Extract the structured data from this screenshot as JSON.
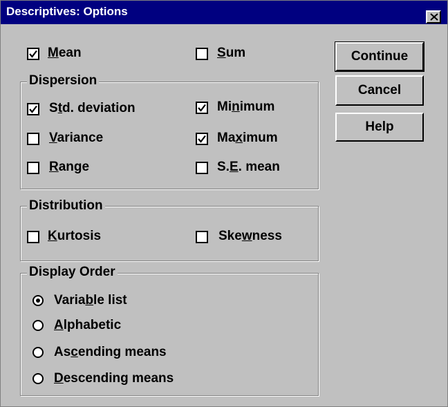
{
  "window": {
    "title": "Descriptives: Options"
  },
  "top_options": [
    {
      "label_parts": [
        "",
        "M",
        "ean"
      ],
      "checked": true
    },
    {
      "label_parts": [
        "",
        "S",
        "um"
      ],
      "checked": false
    }
  ],
  "dispersion": {
    "title": "Dispersion",
    "items": [
      {
        "label_parts": [
          "S",
          "t",
          "d. deviation"
        ],
        "checked": true
      },
      {
        "label_parts": [
          "Mi",
          "n",
          "imum"
        ],
        "checked": true
      },
      {
        "label_parts": [
          "",
          "V",
          "ariance"
        ],
        "checked": false
      },
      {
        "label_parts": [
          "Ma",
          "x",
          "imum"
        ],
        "checked": true
      },
      {
        "label_parts": [
          "",
          "R",
          "ange"
        ],
        "checked": false
      },
      {
        "label_parts": [
          "S.",
          "E",
          ". mean"
        ],
        "checked": false
      }
    ]
  },
  "distribution": {
    "title": "Distribution",
    "items": [
      {
        "label_parts": [
          "",
          "K",
          "urtosis"
        ],
        "checked": false
      },
      {
        "label_parts": [
          "Ske",
          "w",
          "ness"
        ],
        "checked": false
      }
    ]
  },
  "display_order": {
    "title": "Display Order",
    "options": [
      {
        "label_parts": [
          "Varia",
          "b",
          "le list"
        ],
        "selected": true
      },
      {
        "label_parts": [
          "",
          "A",
          "lphabetic"
        ],
        "selected": false
      },
      {
        "label_parts": [
          "As",
          "c",
          "ending means"
        ],
        "selected": false
      },
      {
        "label_parts": [
          "",
          "D",
          "escending means"
        ],
        "selected": false
      }
    ]
  },
  "buttons": {
    "continue": "Continue",
    "cancel": "Cancel",
    "help": "Help"
  }
}
